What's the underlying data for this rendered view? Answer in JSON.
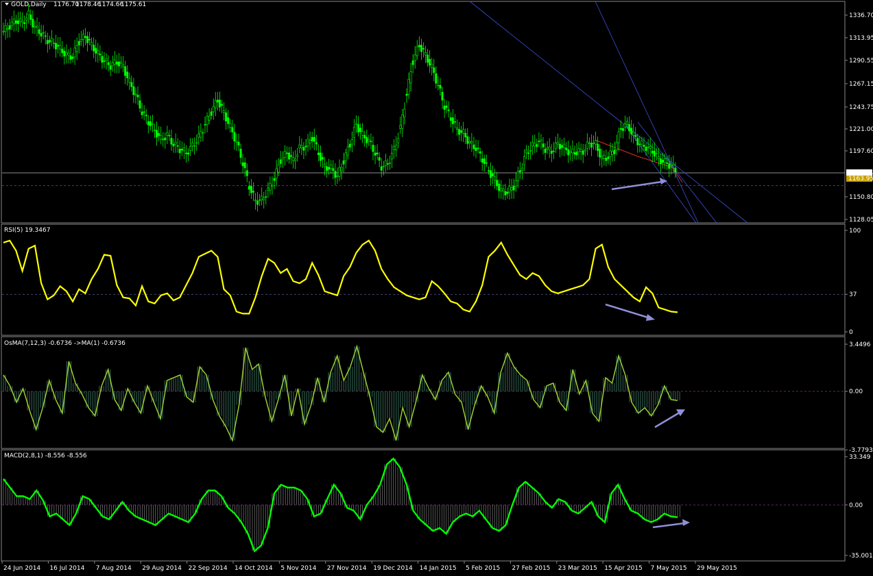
{
  "header": {
    "symbol": "GOLD,Daily",
    "open": "1176.70",
    "high": "1178.46",
    "low": "1174.66",
    "close": "1175.61"
  },
  "colors": {
    "background": "#000000",
    "candle": "#00ff00",
    "rsi_line": "#ffff00",
    "osma_fill": "#2f5a4a",
    "osma_line": "#9acd32",
    "macd_line": "#00ff00",
    "macd_hist": "#b0b0b0",
    "trendline": "#3b4fd8",
    "resistance": "#e03020",
    "arrow": "#8f8fd8",
    "grid_dash": "#5a5aa0",
    "zero_dash": "#8a2a8a",
    "bid_label_bg": "#ffffff",
    "support_label_bg": "#c8a000"
  },
  "chart_data": [
    {
      "type": "candlestick",
      "name": "price",
      "ylim": [
        1128.05,
        1336.7
      ],
      "y_ticks": [
        "1336.70",
        "1313.95",
        "1290.55",
        "1267.15",
        "1243.75",
        "1221.00",
        "1197.60",
        "1175.61",
        "1163.95",
        "1150.80",
        "1128.05"
      ],
      "current_price": "1175.61",
      "support_level": "1163.95",
      "close_series": [
        1320,
        1326,
        1331,
        1329,
        1337,
        1324,
        1318,
        1311,
        1308,
        1302,
        1296,
        1294,
        1310,
        1315,
        1306,
        1297,
        1290,
        1285,
        1289,
        1284,
        1268,
        1255,
        1238,
        1228,
        1219,
        1210,
        1214,
        1205,
        1200,
        1196,
        1203,
        1212,
        1225,
        1238,
        1250,
        1237,
        1222,
        1207,
        1186,
        1162,
        1147,
        1148,
        1158,
        1170,
        1189,
        1196,
        1188,
        1201,
        1203,
        1212,
        1196,
        1182,
        1180,
        1172,
        1188,
        1205,
        1225,
        1214,
        1208,
        1196,
        1182,
        1185,
        1199,
        1221,
        1256,
        1290,
        1306,
        1296,
        1283,
        1265,
        1244,
        1232,
        1220,
        1216,
        1206,
        1201,
        1190,
        1178,
        1168,
        1157,
        1156,
        1162,
        1178,
        1196,
        1203,
        1208,
        1200,
        1198,
        1205,
        1201,
        1196,
        1197,
        1198,
        1206,
        1205,
        1190,
        1192,
        1199,
        1221,
        1225,
        1214,
        1205,
        1202,
        1198,
        1190,
        1186,
        1183,
        1176
      ]
    },
    {
      "type": "line",
      "name": "RSI(5)",
      "label": "RSI(5) 19.3467",
      "ylim": [
        0,
        100
      ],
      "y_ticks": [
        "100",
        "37",
        "0"
      ],
      "values": [
        88,
        90,
        80,
        60,
        82,
        85,
        48,
        32,
        36,
        45,
        40,
        30,
        42,
        38,
        52,
        62,
        76,
        75,
        46,
        34,
        33,
        26,
        45,
        30,
        28,
        36,
        38,
        31,
        34,
        46,
        58,
        74,
        77,
        80,
        74,
        42,
        36,
        20,
        18,
        18,
        34,
        55,
        72,
        68,
        58,
        62,
        50,
        48,
        52,
        68,
        56,
        40,
        38,
        36,
        55,
        64,
        78,
        86,
        90,
        80,
        62,
        52,
        44,
        40,
        36,
        34,
        32,
        34,
        50,
        45,
        38,
        30,
        28,
        22,
        20,
        30,
        46,
        74,
        80,
        88,
        76,
        66,
        56,
        52,
        58,
        55,
        46,
        40,
        38,
        40,
        42,
        44,
        46,
        52,
        82,
        86,
        64,
        52,
        46,
        40,
        34,
        30,
        44,
        38,
        24,
        22,
        20,
        19.35
      ]
    },
    {
      "type": "bar",
      "name": "OsMA(7,12,3)",
      "label": "OsMA(7,12,3) -0.6736   ->MA(1) -0.6736",
      "ylim": [
        -3.7793,
        3.4496
      ],
      "y_ticks": [
        "3.4496",
        "0.00",
        "-3.7793"
      ],
      "values": [
        1.2,
        0.4,
        -0.8,
        0.2,
        -1.4,
        -2.8,
        -1.2,
        0.8,
        -0.6,
        -1.6,
        2.2,
        0.6,
        -0.2,
        -1.2,
        -1.8,
        0.4,
        1.6,
        -0.6,
        -1.4,
        0.2,
        -0.8,
        -1.6,
        0.4,
        -0.8,
        -2.0,
        0.8,
        1.0,
        1.2,
        -0.4,
        -0.8,
        1.8,
        1.2,
        -0.6,
        -1.8,
        -2.6,
        -3.6,
        -1.0,
        3.2,
        1.6,
        2.0,
        -0.4,
        -2.2,
        -0.6,
        1.2,
        -1.8,
        0.2,
        -2.4,
        -1.0,
        1.0,
        -0.8,
        1.4,
        2.6,
        0.8,
        1.8,
        3.3,
        1.4,
        -0.4,
        -2.6,
        -3.0,
        -2.0,
        -3.6,
        -1.2,
        -2.6,
        -0.8,
        1.2,
        0.2,
        -0.6,
        0.8,
        1.4,
        -0.2,
        -0.8,
        -2.8,
        -1.0,
        0.4,
        -0.4,
        -1.6,
        1.4,
        2.8,
        1.8,
        1.2,
        0.8,
        -0.6,
        -1.2,
        0.4,
        0.6,
        -0.8,
        -1.4,
        1.6,
        -0.2,
        0.8,
        -1.6,
        -2.2,
        1.0,
        0.6,
        2.6,
        1.2,
        -0.8,
        -1.6,
        -1.2,
        -1.8,
        -1.0,
        0.4,
        -0.6,
        -0.67
      ]
    },
    {
      "type": "bar",
      "name": "MACD(2,8,1)",
      "label": "MACD(2,8,1) -8.556 -8.556",
      "ylim": [
        -35.001,
        33.349
      ],
      "y_ticks": [
        "33.349",
        "0.00",
        "-35.001"
      ],
      "values": [
        18,
        12,
        6,
        6,
        4,
        10,
        3,
        -8,
        -6,
        -10,
        -14,
        -6,
        6,
        4,
        -2,
        -8,
        -10,
        -4,
        2,
        -4,
        -8,
        -10,
        -12,
        -14,
        -10,
        -6,
        -8,
        -10,
        -12,
        -6,
        4,
        10,
        10,
        6,
        -2,
        -6,
        -12,
        -20,
        -32,
        -28,
        -16,
        8,
        14,
        12,
        12,
        10,
        4,
        -8,
        -6,
        4,
        14,
        8,
        -2,
        -4,
        -10,
        0,
        6,
        14,
        28,
        32,
        26,
        14,
        -4,
        -10,
        -14,
        -18,
        -16,
        -20,
        -12,
        -8,
        -6,
        -8,
        -4,
        -10,
        -16,
        -18,
        -14,
        0,
        12,
        16,
        12,
        8,
        2,
        -2,
        4,
        2,
        -4,
        -6,
        -2,
        2,
        -8,
        -12,
        8,
        14,
        4,
        -4,
        -6,
        -10,
        -12,
        -10,
        -6,
        -8,
        -8.56
      ]
    }
  ],
  "x_axis": {
    "labels": [
      "24 Jun 2014",
      "16 Jul 2014",
      "7 Aug 2014",
      "29 Aug 2014",
      "22 Sep 2014",
      "14 Oct 2014",
      "5 Nov 2014",
      "27 Nov 2014",
      "19 Dec 2014",
      "14 Jan 2015",
      "5 Feb 2015",
      "27 Feb 2015",
      "23 Mar 2015",
      "15 Apr 2015",
      "7 May 2015",
      "29 May 2015"
    ]
  }
}
